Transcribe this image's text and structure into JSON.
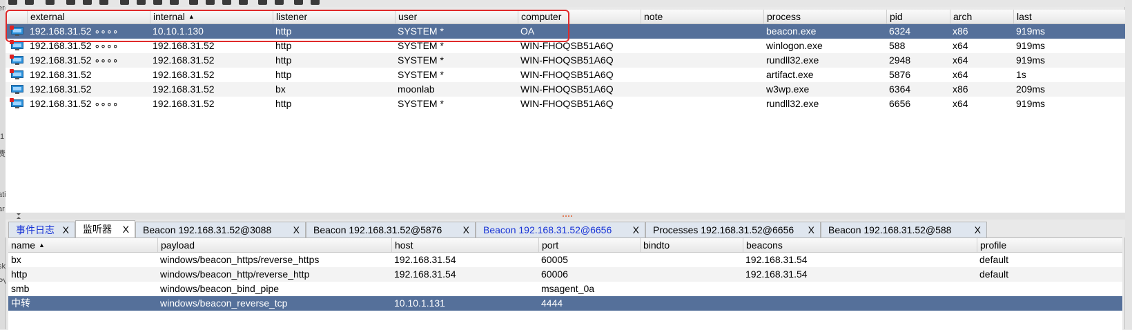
{
  "sessions": {
    "columns": [
      "external",
      "internal",
      "listener",
      "user",
      "computer",
      "note",
      "process",
      "pid",
      "arch",
      "last"
    ],
    "rows": [
      {
        "external": "192.168.31.52 ∘∘∘∘",
        "internal": "10.10.1.130",
        "listener": "http",
        "user": "SYSTEM *",
        "computer": "OA",
        "note": "",
        "process": "beacon.exe",
        "pid": "6324",
        "arch": "x86",
        "last": "919ms"
      },
      {
        "external": "192.168.31.52 ∘∘∘∘",
        "internal": "192.168.31.52",
        "listener": "http",
        "user": "SYSTEM *",
        "computer": "WIN-FHOQSB51A6Q",
        "note": "",
        "process": "winlogon.exe",
        "pid": "588",
        "arch": "x64",
        "last": "919ms"
      },
      {
        "external": "192.168.31.52 ∘∘∘∘",
        "internal": "192.168.31.52",
        "listener": "http",
        "user": "SYSTEM *",
        "computer": "WIN-FHOQSB51A6Q",
        "note": "",
        "process": "rundll32.exe",
        "pid": "2948",
        "arch": "x64",
        "last": "919ms"
      },
      {
        "external": "192.168.31.52",
        "internal": "192.168.31.52",
        "listener": "http",
        "user": "SYSTEM *",
        "computer": "WIN-FHOQSB51A6Q",
        "note": "",
        "process": "artifact.exe",
        "pid": "5876",
        "arch": "x64",
        "last": "1s"
      },
      {
        "external": "192.168.31.52",
        "internal": "192.168.31.52",
        "listener": "bx",
        "user": "moonlab",
        "computer": "WIN-FHOQSB51A6Q",
        "note": "",
        "process": "w3wp.exe",
        "pid": "6364",
        "arch": "x86",
        "last": "209ms"
      },
      {
        "external": "192.168.31.52 ∘∘∘∘",
        "internal": "192.168.31.52",
        "listener": "http",
        "user": "SYSTEM *",
        "computer": "WIN-FHOQSB51A6Q",
        "note": "",
        "process": "rundll32.exe",
        "pid": "6656",
        "arch": "x64",
        "last": "919ms"
      }
    ],
    "sort_arrow": "▲"
  },
  "tabs": [
    {
      "label": "事件日志",
      "close": "X"
    },
    {
      "label": "监听器",
      "close": "X"
    },
    {
      "label": "Beacon 192.168.31.52@3088",
      "close": "X"
    },
    {
      "label": "Beacon 192.168.31.52@5876",
      "close": "X"
    },
    {
      "label": "Beacon 192.168.31.52@6656",
      "close": "X"
    },
    {
      "label": "Processes 192.168.31.52@6656",
      "close": "X"
    },
    {
      "label": "Beacon 192.168.31.52@588",
      "close": "X"
    }
  ],
  "listeners": {
    "columns": [
      "name",
      "payload",
      "host",
      "port",
      "bindto",
      "beacons",
      "profile"
    ],
    "rows": [
      {
        "name": "bx",
        "payload": "windows/beacon_https/reverse_https",
        "host": "192.168.31.54",
        "port": "60005",
        "bindto": "",
        "beacons": "192.168.31.54",
        "profile": "default"
      },
      {
        "name": "http",
        "payload": "windows/beacon_http/reverse_http",
        "host": "192.168.31.54",
        "port": "60006",
        "bindto": "",
        "beacons": "192.168.31.54",
        "profile": "default"
      },
      {
        "name": "smb",
        "payload": "windows/beacon_bind_pipe",
        "host": "",
        "port": "msagent_0a",
        "bindto": "",
        "beacons": "",
        "profile": ""
      },
      {
        "name": "中转",
        "payload": "windows/beacon_reverse_tcp",
        "host": "10.10.1.131",
        "port": "4444",
        "bindto": "",
        "beacons": "",
        "profile": ""
      }
    ]
  },
  "colors": {
    "selection": "#55709a",
    "highlight_box": "#e02a2a",
    "active_tab_text": "#1733d6"
  }
}
